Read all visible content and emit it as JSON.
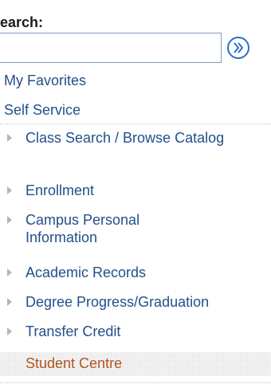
{
  "search": {
    "label": "earch:",
    "value": "",
    "placeholder": ""
  },
  "menu": {
    "favorites": "My Favorites",
    "self_service": "Self Service",
    "items": [
      {
        "label": "Class Search / Browse Catalog",
        "icon": "triangle-right-icon"
      },
      {
        "label": "Enrollment",
        "icon": "triangle-right-icon"
      },
      {
        "label": "Campus Personal Information",
        "icon": "triangle-right-icon"
      },
      {
        "label": "Academic Records",
        "icon": "triangle-right-icon"
      },
      {
        "label": "Degree Progress/Graduation",
        "icon": "triangle-right-icon"
      },
      {
        "label": "Transfer Credit",
        "icon": "triangle-right-icon"
      }
    ],
    "current": "Student Centre"
  },
  "colors": {
    "link": "#22508a",
    "current": "#b0541a",
    "go_button": "#2a6fcf"
  }
}
